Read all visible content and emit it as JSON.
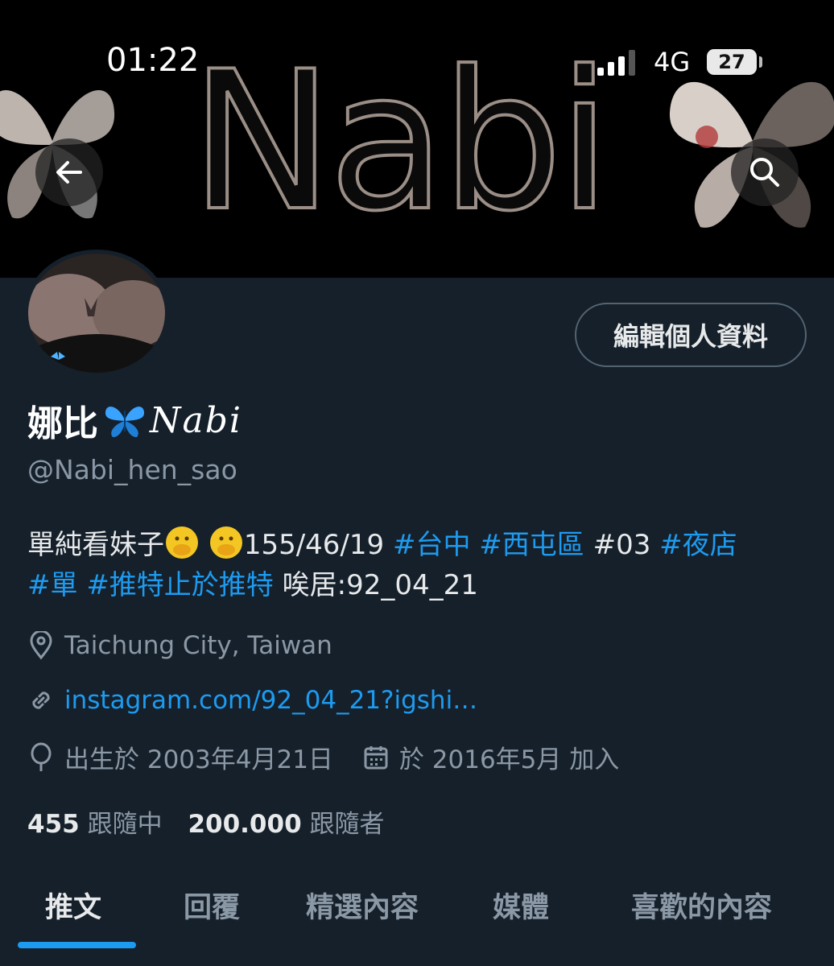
{
  "status_bar": {
    "time": "01:22",
    "network": "4G",
    "battery": "27"
  },
  "banner": {
    "word": "Nabi"
  },
  "actions": {
    "edit_profile": "編輯個人資料"
  },
  "profile": {
    "display_name": "娜比",
    "name_script": "Nabi",
    "handle": "@Nabi_hen_sao"
  },
  "bio": {
    "text_1": "單純看妹子",
    "text_2": "155/46/19",
    "tag_taichung": "#台中",
    "tag_xitun": "#西屯區",
    "tag_03": "#03",
    "tag_nightclub": "#夜店",
    "tag_single": "#單",
    "tag_twitter": "#推特止於推特",
    "text_3": "唉居:92_04_21"
  },
  "meta": {
    "location": "Taichung City, Taiwan",
    "website": "instagram.com/92_04_21?igshi…",
    "birthday": "出生於 2003年4月21日",
    "joined": "於 2016年5月 加入"
  },
  "stats": {
    "following_count": "455",
    "following_label": "跟隨中",
    "followers_count": "200.000",
    "followers_label": "跟隨者"
  },
  "tabs": [
    "推文",
    "回覆",
    "精選內容",
    "媒體",
    "喜歡的內容"
  ],
  "colors": {
    "background": "#15202b",
    "accent": "#1d9bf0",
    "secondary_text": "#8b98a5"
  }
}
